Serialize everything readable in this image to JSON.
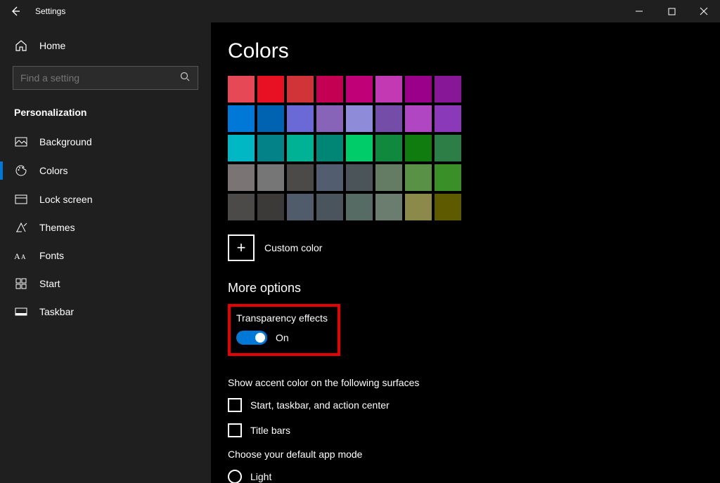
{
  "window": {
    "title": "Settings"
  },
  "sidebar": {
    "home": "Home",
    "search_placeholder": "Find a setting",
    "section": "Personalization",
    "items": [
      {
        "label": "Background"
      },
      {
        "label": "Colors"
      },
      {
        "label": "Lock screen"
      },
      {
        "label": "Themes"
      },
      {
        "label": "Fonts"
      },
      {
        "label": "Start"
      },
      {
        "label": "Taskbar"
      }
    ]
  },
  "main": {
    "heading": "Colors",
    "swatches": [
      [
        "#e74856",
        "#e81123",
        "#d13438",
        "#c30052",
        "#bf0077",
        "#c239b3",
        "#9a0089",
        "#881798"
      ],
      [
        "#0078d7",
        "#0063b1",
        "#6b69d6",
        "#8764b8",
        "#8e8cd8",
        "#744da9",
        "#b146c2",
        "#8a3ab9"
      ],
      [
        "#00b7c3",
        "#038387",
        "#00b294",
        "#018574",
        "#00cc6a",
        "#10893e",
        "#107c10",
        "#2d7d46"
      ],
      [
        "#7a7574",
        "#767676",
        "#4c4a48",
        "#525e6f",
        "#4a5459",
        "#647c64",
        "#599147",
        "#3a8f29"
      ],
      [
        "#4c4a48",
        "#3b3a39",
        "#515c6b",
        "#49545c",
        "#566b63",
        "#6b7d6e",
        "#8b8a4a",
        "#5d5a00"
      ]
    ],
    "custom_color": "Custom color",
    "more_options": "More options",
    "transparency": {
      "label": "Transparency effects",
      "state": "On"
    },
    "accent_surfaces": {
      "label": "Show accent color on the following surfaces",
      "opts": [
        "Start, taskbar, and action center",
        "Title bars"
      ]
    },
    "app_mode": {
      "label": "Choose your default app mode",
      "opts": [
        "Light"
      ]
    }
  }
}
